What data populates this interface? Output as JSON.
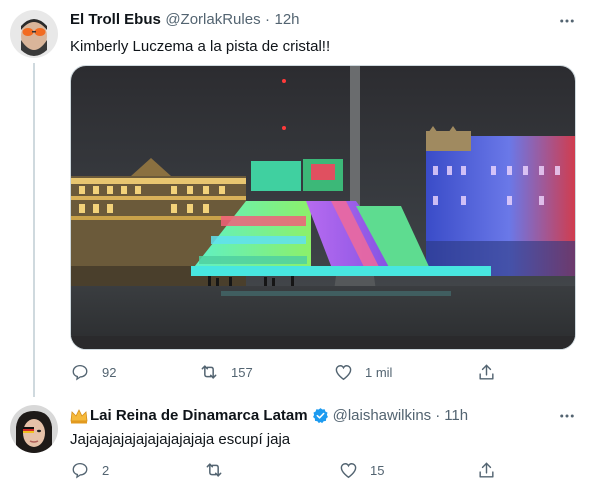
{
  "tweet1": {
    "display_name": "El Troll Ebus",
    "handle": "@ZorlakRules",
    "separator": "·",
    "time": "12h",
    "text": "Kimberly Luczema a la pista de cristal!!",
    "replies": "92",
    "retweets": "157",
    "likes": "1 mil"
  },
  "tweet2": {
    "display_name": "Lai Reina de Dinamarca Latam",
    "handle": "@laishawilkins",
    "separator": "·",
    "time": "11h",
    "text": "Jajajajajajajajajajajaja escupí jaja",
    "replies": "2",
    "retweets": "",
    "likes": "15"
  },
  "icons": {
    "more": "more-horizontal-icon",
    "reply": "reply-icon",
    "retweet": "retweet-icon",
    "like": "heart-icon",
    "share": "share-icon",
    "verified": "verified-badge-icon",
    "crown": "crown-emoji-icon"
  },
  "colors": {
    "text_primary": "#0f1419",
    "text_secondary": "#536471",
    "verified_blue": "#1d9bf0",
    "divider": "#cfd9de"
  }
}
